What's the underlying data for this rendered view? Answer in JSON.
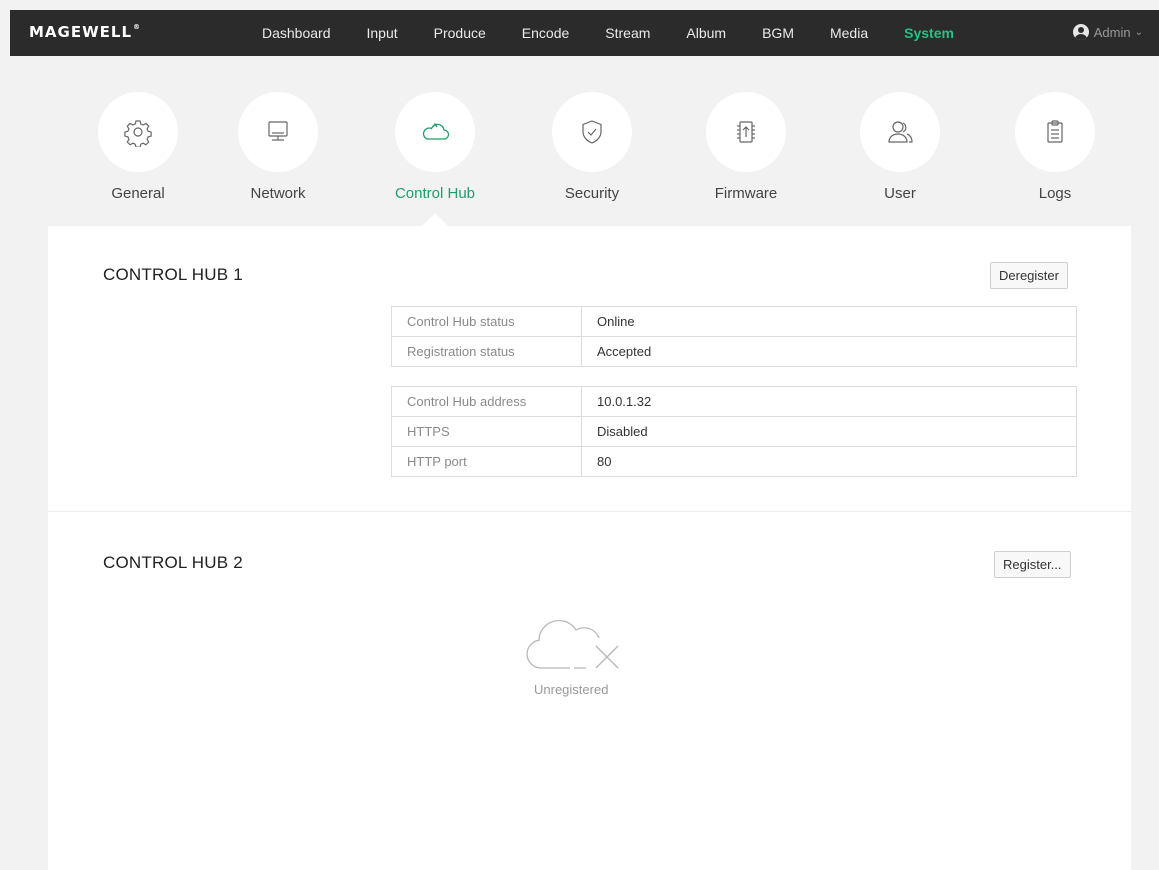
{
  "brand": {
    "logo": "MAGEWELL",
    "reg": "®"
  },
  "nav": {
    "items": [
      "Dashboard",
      "Input",
      "Produce",
      "Encode",
      "Stream",
      "Album",
      "BGM",
      "Media",
      "System"
    ],
    "active": "System",
    "user": "Admin"
  },
  "tiles": [
    {
      "label": "General",
      "icon": "gear-icon"
    },
    {
      "label": "Network",
      "icon": "monitor-icon"
    },
    {
      "label": "Control Hub",
      "icon": "cloud-icon"
    },
    {
      "label": "Security",
      "icon": "shield-icon"
    },
    {
      "label": "Firmware",
      "icon": "firmware-chip-icon"
    },
    {
      "label": "User",
      "icon": "users-icon"
    },
    {
      "label": "Logs",
      "icon": "clipboard-icon"
    }
  ],
  "hub1": {
    "title": "CONTROL HUB 1",
    "button": "Deregister",
    "status_rows": [
      {
        "key": "Control Hub status",
        "value": "Online"
      },
      {
        "key": "Registration status",
        "value": "Accepted"
      }
    ],
    "address_rows": [
      {
        "key": "Control Hub address",
        "value": "10.0.1.32"
      },
      {
        "key": "HTTPS",
        "value": "Disabled"
      },
      {
        "key": "HTTP port",
        "value": "80"
      }
    ]
  },
  "hub2": {
    "title": "CONTROL HUB 2",
    "button": "Register...",
    "state": "Unregistered"
  },
  "colors": {
    "accent": "#26c281",
    "nav_bg": "#2b2b2b",
    "page_bg": "#f2f2f2"
  }
}
